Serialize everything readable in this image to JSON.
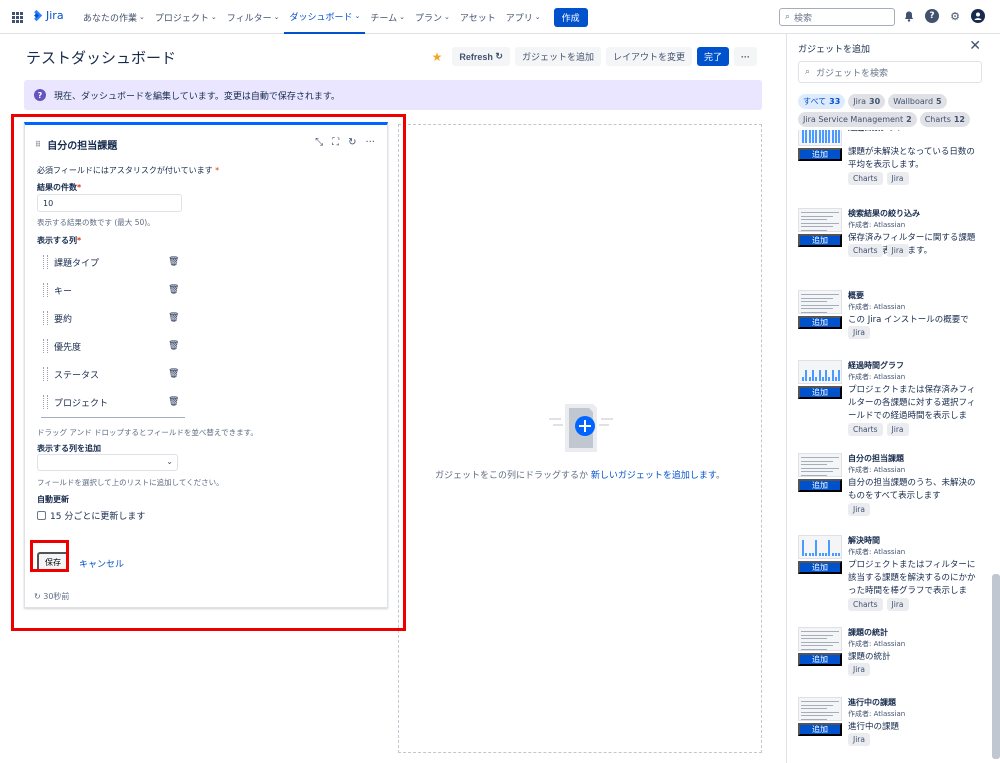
{
  "nav": {
    "logo": "Jira",
    "items": [
      {
        "label": "あなたの作業",
        "chev": true
      },
      {
        "label": "プロジェクト",
        "chev": true
      },
      {
        "label": "フィルター",
        "chev": true
      },
      {
        "label": "ダッシュボード",
        "chev": true,
        "active": true
      },
      {
        "label": "チーム",
        "chev": true
      },
      {
        "label": "プラン",
        "chev": true
      },
      {
        "label": "アセット",
        "chev": false
      },
      {
        "label": "アプリ",
        "chev": true
      }
    ],
    "create": "作成",
    "search_placeholder": "検索"
  },
  "page": {
    "title": "テストダッシュボード",
    "refresh": "Refresh",
    "add_gadget": "ガジェットを追加",
    "change_layout": "レイアウトを変更",
    "done": "完了",
    "more": "···",
    "banner": "現在、ダッシュボードを編集しています。変更は自動で保存されます。"
  },
  "gadget": {
    "title": "自分の担当課題",
    "required_note": "必須フィールドにはアスタリスクが付いています",
    "count_label": "結果の件数",
    "count_value": "10",
    "count_help": "表示する結果の数です (最大 50)。",
    "columns_label": "表示する列",
    "columns": [
      "課題タイプ",
      "キー",
      "要約",
      "優先度",
      "ステータス",
      "プロジェクト"
    ],
    "drag_help": "ドラッグ アンド ドロップするとフィールドを並べ替えできます。",
    "add_column_label": "表示する列を追加",
    "add_column_help": "フィールドを選択して上のリストに追加してください。",
    "auto_refresh_label": "自動更新",
    "auto_refresh_option": "15 分ごとに更新します",
    "save": "保存",
    "cancel": "キャンセル",
    "updated": "30秒前"
  },
  "dropzone": {
    "text_before": "ガジェットをこの列にドラッグするか ",
    "link": "新しいガジェットを追加します",
    "text_after": "。"
  },
  "sidebar": {
    "title": "ガジェットを追加",
    "search_placeholder": "ガジェットを検索",
    "filters": [
      {
        "label": "すべて",
        "count": "33",
        "active": true
      },
      {
        "label": "Jira",
        "count": "30"
      },
      {
        "label": "Wallboard",
        "count": "5"
      },
      {
        "label": "Jira Service Management",
        "count": "2"
      },
      {
        "label": "Charts",
        "count": "12"
      }
    ],
    "add_label": "追加",
    "gadgets": [
      {
        "name": "経過日数グラフ",
        "author": "",
        "desc": "課題が未解決となっている日数の平均を表示します。",
        "tags": [
          "Charts",
          "Jira"
        ]
      },
      {
        "name": "検索結果の絞り込み",
        "author": "作成者: Atlassian",
        "desc": "保存済みフィルターに関する課題や結果を表示します。",
        "tags": [
          "Charts",
          "Jira"
        ]
      },
      {
        "name": "概要",
        "author": "作成者: Atlassian",
        "desc": "この Jira インストールの概要です。",
        "tags": [
          "Jira"
        ]
      },
      {
        "name": "経過時間グラフ",
        "author": "作成者: Atlassian",
        "desc": "プロジェクトまたは保存済みフィルターの各課題に対する選択フィールドでの経過時間を表示します。",
        "tags": [
          "Charts",
          "Jira"
        ]
      },
      {
        "name": "自分の担当課題",
        "author": "作成者: Atlassian",
        "desc": "自分の担当課題のうち、未解決のものをすべて表示します",
        "tags": [
          "Jira"
        ]
      },
      {
        "name": "解決時間",
        "author": "作成者: Atlassian",
        "desc": "プロジェクトまたはフィルターに該当する課題を解決するのにかかった時間を棒グラフで表示します。",
        "tags": [
          "Charts",
          "Jira"
        ]
      },
      {
        "name": "課題の統計",
        "author": "作成者: Atlassian",
        "desc": "課題の統計",
        "tags": [
          "Jira"
        ]
      },
      {
        "name": "進行中の課題",
        "author": "作成者: Atlassian",
        "desc": "進行中の課題",
        "tags": [
          "Jira"
        ]
      }
    ]
  }
}
